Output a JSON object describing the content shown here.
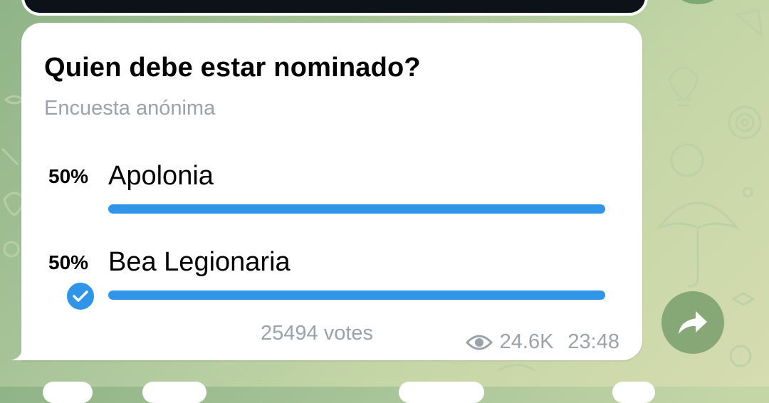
{
  "chat": {
    "poll": {
      "question": "Quien debe estar nominado?",
      "type_label": "Encuesta anónima",
      "options": [
        {
          "percent_label": "50%",
          "text": "Apolonia",
          "fraction": 0.5,
          "chosen": false
        },
        {
          "percent_label": "50%",
          "text": "Bea Legionaria",
          "fraction": 0.5,
          "chosen": true
        }
      ],
      "votes_label": "25494 votes",
      "views": "24.6K",
      "time": "23:48"
    },
    "icons": {
      "chosen": "check-circle-icon",
      "views": "eye-icon",
      "share": "share-arrow-icon"
    },
    "colors": {
      "accent": "#2f95e8",
      "muted_text": "#9aa3ab",
      "bubble": "#ffffff"
    }
  }
}
